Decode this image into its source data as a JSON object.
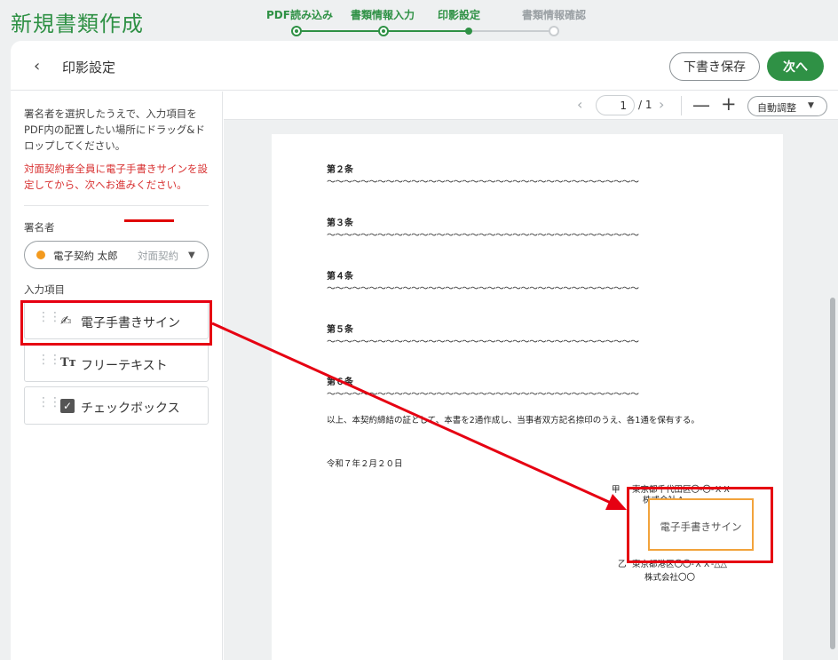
{
  "app": {
    "title": "新規書類作成"
  },
  "stepper": {
    "steps": [
      {
        "label": "PDF読み込み",
        "state": "done"
      },
      {
        "label": "書類情報入力",
        "state": "done"
      },
      {
        "label": "印影設定",
        "state": "current"
      },
      {
        "label": "書類情報確認",
        "state": "todo"
      }
    ]
  },
  "header": {
    "back_icon": "chevron-left-icon",
    "title": "印影設定",
    "save_draft_label": "下書き保存",
    "next_label": "次へ"
  },
  "sidebar": {
    "instruction": "署名者を選択したうえで、入力項目をPDF内の配置したい場所にドラッグ&ドロップしてください。",
    "warning": "対面契約者全員に電子手書きサインを設定してから、次へお進みください。",
    "signer_label": "署名者",
    "signer": {
      "name": "電子契約 太郎",
      "tag": "対面契約",
      "dot_color": "#f39a1e"
    },
    "fields_label": "入力項目",
    "fields": [
      {
        "label": "電子手書きサイン",
        "icon": "signature-pen-icon"
      },
      {
        "label": "フリーテキスト",
        "icon": "text-tt-icon"
      },
      {
        "label": "チェックボックス",
        "icon": "checkbox-icon"
      }
    ]
  },
  "viewer": {
    "page_current": "1",
    "page_total": "/ 1",
    "zoom_label": "自動調整"
  },
  "document": {
    "articles": [
      {
        "heading": "第２条",
        "body": "〜〜〜〜〜〜〜〜〜〜〜〜〜〜〜〜〜〜〜〜〜〜〜〜〜〜〜〜〜〜〜〜〜〜〜〜〜"
      },
      {
        "heading": "第３条",
        "body": "〜〜〜〜〜〜〜〜〜〜〜〜〜〜〜〜〜〜〜〜〜〜〜〜〜〜〜〜〜〜〜〜〜〜〜〜〜"
      },
      {
        "heading": "第４条",
        "body": "〜〜〜〜〜〜〜〜〜〜〜〜〜〜〜〜〜〜〜〜〜〜〜〜〜〜〜〜〜〜〜〜〜〜〜〜〜"
      },
      {
        "heading": "第５条",
        "body": "〜〜〜〜〜〜〜〜〜〜〜〜〜〜〜〜〜〜〜〜〜〜〜〜〜〜〜〜〜〜〜〜〜〜〜〜〜"
      },
      {
        "heading": "第６条",
        "body": "〜〜〜〜〜〜〜〜〜〜〜〜〜〜〜〜〜〜〜〜〜〜〜〜〜〜〜〜〜〜〜〜〜〜〜〜〜"
      }
    ],
    "closing": "以上、本契約締結の証として、本書を2通作成し、当事者双方記名捺印のうえ、各1通を保有する。",
    "date": "令和７年２月２０日",
    "party_a_label": "甲",
    "party_a_address": "東京都千代田区〇-〇-ＸＸ",
    "party_a_company": "株式会社Ａ",
    "party_b_label": "乙",
    "party_b_address": "東京都港区〇〇-ＸＸ-△△",
    "party_b_company": "株式会社〇〇",
    "placed_field_label": "電子手書きサイン"
  },
  "colors": {
    "brand_green": "#2f9145",
    "warning_red": "#d83232",
    "annotation_red": "#e60012",
    "field_border_orange": "#f2a33c"
  }
}
